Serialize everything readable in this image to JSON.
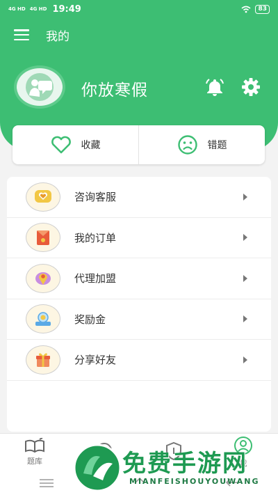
{
  "status_bar": {
    "network_1": "4G HD",
    "network_2": "4G HD",
    "time": "19:49",
    "battery": "83"
  },
  "header": {
    "title": "我的"
  },
  "profile": {
    "username": "你放寒假"
  },
  "quick_actions": [
    {
      "label": "收藏",
      "icon": "heart-icon"
    },
    {
      "label": "错题",
      "icon": "sad-face-icon"
    }
  ],
  "menu": [
    {
      "label": "咨询客服",
      "icon": "heart-chat-icon"
    },
    {
      "label": "我的订单",
      "icon": "order-envelope-icon"
    },
    {
      "label": "代理加盟",
      "icon": "location-pin-icon"
    },
    {
      "label": "奖励金",
      "icon": "reward-icon"
    },
    {
      "label": "分享好友",
      "icon": "gift-icon"
    }
  ],
  "tabs": [
    {
      "label": "题库",
      "icon": "book-icon"
    },
    {
      "label": "",
      "icon": "chat-icon"
    },
    {
      "label": "",
      "icon": "shield-icon"
    },
    {
      "label": "我",
      "icon": "user-icon"
    }
  ],
  "watermark": {
    "title": "免费手游网",
    "subtitle": "MIANFEISHOUYOUWANG"
  },
  "colors": {
    "brand": "#3dbe73",
    "background": "#f3f3f3"
  }
}
